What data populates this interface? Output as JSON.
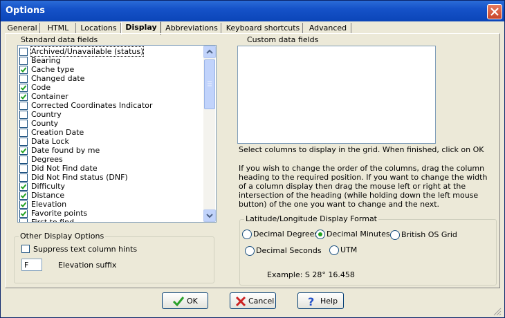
{
  "window": {
    "title": "Options"
  },
  "tabs": [
    {
      "label": "General"
    },
    {
      "label": "HTML"
    },
    {
      "label": "Locations"
    },
    {
      "label": "Display"
    },
    {
      "label": "Abbreviations"
    },
    {
      "label": "Keyboard shortcuts"
    },
    {
      "label": "Advanced"
    }
  ],
  "active_tab": "Display",
  "standard_fields": {
    "label": "Standard data fields",
    "items": [
      {
        "label": "Archived/Unavailable (status)",
        "checked": false,
        "focused": true
      },
      {
        "label": "Bearing",
        "checked": false
      },
      {
        "label": "Cache type",
        "checked": true
      },
      {
        "label": "Changed date",
        "checked": false
      },
      {
        "label": "Code",
        "checked": true
      },
      {
        "label": "Container",
        "checked": true
      },
      {
        "label": "Corrected Coordinates Indicator",
        "checked": false
      },
      {
        "label": "Country",
        "checked": false
      },
      {
        "label": "County",
        "checked": false
      },
      {
        "label": "Creation Date",
        "checked": false
      },
      {
        "label": "Data Lock",
        "checked": false
      },
      {
        "label": "Date found by me",
        "checked": true
      },
      {
        "label": "Degrees",
        "checked": false
      },
      {
        "label": "Did Not Find date",
        "checked": false
      },
      {
        "label": "Did Not Find status (DNF)",
        "checked": false
      },
      {
        "label": "Difficulty",
        "checked": true
      },
      {
        "label": "Distance",
        "checked": true
      },
      {
        "label": "Elevation",
        "checked": true
      },
      {
        "label": "Favorite points",
        "checked": true
      },
      {
        "label": "First to find",
        "checked": false
      }
    ]
  },
  "custom_fields": {
    "label": "Custom data fields",
    "instructions": "Select columns to display in the grid. When finished, click on OK",
    "help": "If you wish to change the order of the columns, drag the column heading to the required position. If you want to change the width of a column display then drag the mouse left or right at the intersection of the heading (while holding down the left mouse button)  of the one you want to change and the next."
  },
  "other_options": {
    "label": "Other Display Options",
    "suppress_label": "Suppress text column hints",
    "suppress_checked": false,
    "elevation_value": "F",
    "elevation_label": "Elevation suffix"
  },
  "latlon": {
    "label": "Latitude/Longitude Display Format",
    "options": [
      {
        "label": "Decimal Degrees",
        "selected": false
      },
      {
        "label": "Decimal Minutes",
        "selected": true
      },
      {
        "label": "British OS Grid",
        "selected": false
      },
      {
        "label": "Decimal Seconds",
        "selected": false
      },
      {
        "label": "UTM",
        "selected": false
      }
    ],
    "example": "Example: S 28° 16.458"
  },
  "buttons": {
    "ok": "OK",
    "cancel": "Cancel",
    "help": "Help"
  },
  "colors": {
    "titlebar": "#0b45b8",
    "checkmark": "#21a121",
    "ok_icon": "#2aa02a",
    "cancel_icon": "#cc2222",
    "help_icon": "#2250c8"
  }
}
